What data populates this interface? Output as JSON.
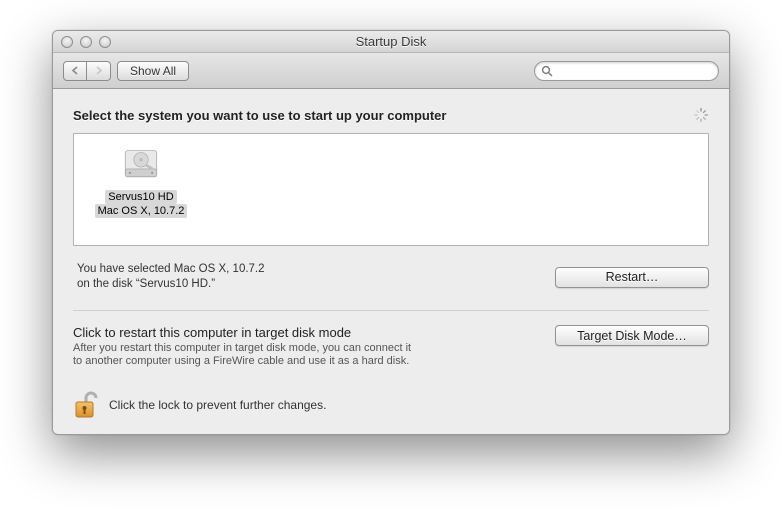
{
  "window": {
    "title": "Startup Disk"
  },
  "toolbar": {
    "show_all_label": "Show All",
    "search_placeholder": ""
  },
  "main": {
    "heading": "Select the system you want to use to start up your computer",
    "disks": [
      {
        "name": "Servus10 HD",
        "os": "Mac OS X, 10.7.2"
      }
    ],
    "selection_line1": "You have selected Mac OS X, 10.7.2",
    "selection_line2": "on the disk “Servus10 HD.”",
    "restart_label": "Restart…"
  },
  "tdm": {
    "heading": "Click to restart this computer in target disk mode",
    "desc1": "After you restart this computer in target disk mode, you can connect it",
    "desc2": "to another computer using a FireWire cable and use it as a hard disk.",
    "button_label": "Target Disk Mode…"
  },
  "lock": {
    "text": "Click the lock to prevent further changes."
  }
}
